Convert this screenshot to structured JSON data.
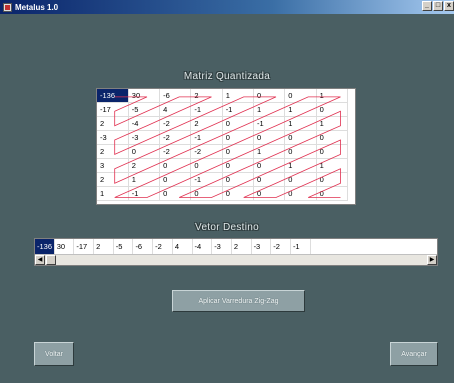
{
  "window": {
    "title": "Metalus 1.0",
    "controls": {
      "minimize": "_",
      "maximize": "□",
      "close": "x"
    }
  },
  "matrix": {
    "title": "Matriz Quantizada",
    "rows": [
      [
        "-136",
        "30",
        "-6",
        "2",
        "1",
        "0",
        "0",
        "1"
      ],
      [
        "-17",
        "-5",
        "4",
        "-1",
        "-1",
        "1",
        "1",
        "0"
      ],
      [
        "2",
        "-4",
        "-2",
        "2",
        "0",
        "-1",
        "1",
        "1"
      ],
      [
        "-3",
        "-3",
        "-2",
        "-1",
        "0",
        "0",
        "0",
        "0"
      ],
      [
        "2",
        "0",
        "-2",
        "-2",
        "0",
        "1",
        "0",
        "0"
      ],
      [
        "3",
        "2",
        "0",
        "0",
        "0",
        "0",
        "1",
        "1"
      ],
      [
        "2",
        "1",
        "0",
        "-1",
        "0",
        "0",
        "0",
        "0"
      ],
      [
        "1",
        "-1",
        "0",
        "0",
        "0",
        "0",
        "0",
        "0"
      ]
    ],
    "zigzag_color": "#e03050"
  },
  "vector": {
    "title": "Vetor Destino",
    "values": [
      "-136",
      "30",
      "-17",
      "2",
      "-5",
      "-6",
      "-2",
      "4",
      "-4",
      "-3",
      "2",
      "-3",
      "-2",
      "-1"
    ]
  },
  "buttons": {
    "zigzag": "Aplicar Varredura Zig-Zag",
    "back": "Voltar",
    "next": "Avançar"
  }
}
